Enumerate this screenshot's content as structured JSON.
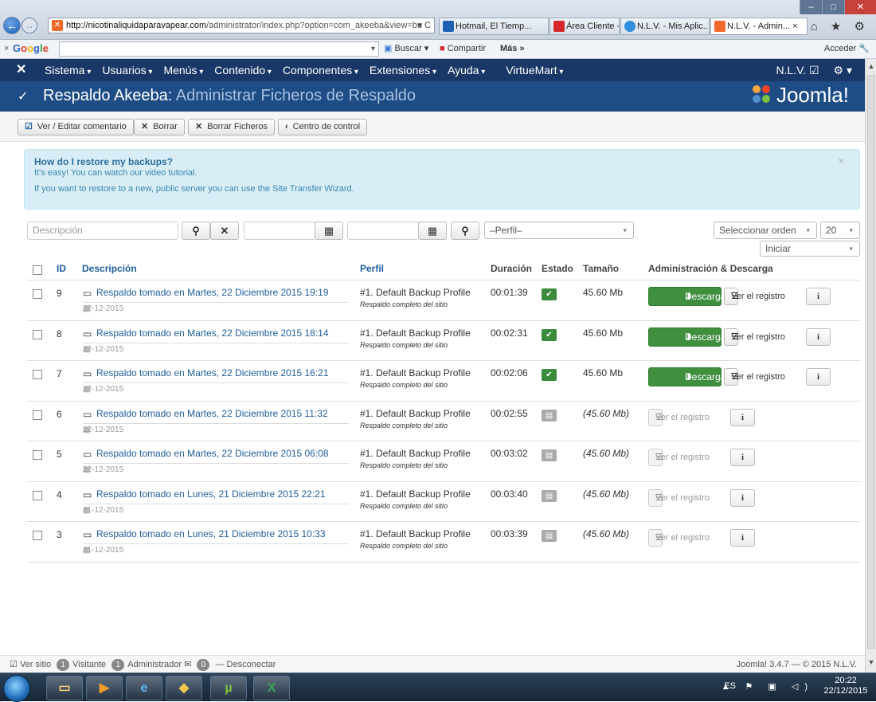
{
  "browser": {
    "url_host": "http://nicotinaliquidaparavapear.com",
    "url_path": "/administrator/index.php?option=com_akeeba&view=bu",
    "url_controls": "▾ C",
    "tabs": [
      {
        "label": "Hotmail, El Tiemp...",
        "color": "#1e5fb4"
      },
      {
        "label": "Área Cliente - We...",
        "color": "#d4262b"
      },
      {
        "label": "N.L.V. - Mis Aplic...",
        "color": "#2f8fdc"
      },
      {
        "label": "N.L.V. - Admin...",
        "color": "#f26a2b",
        "active": true
      }
    ],
    "tab_close": "×",
    "window_controls": {
      "minimize": "–",
      "maximize": "□",
      "close": "✕"
    },
    "right_icons": "⌂ ★ ⚙"
  },
  "google_bar": {
    "close": "×",
    "logo": "Google",
    "search_btn": "Buscar",
    "share_btn": "Compartir",
    "more": "Más »",
    "signin": "Acceder"
  },
  "joomla_nav": {
    "logo": "✕",
    "menu": [
      "Sistema",
      "Usuarios",
      "Menús",
      "Contenido",
      "Componentes",
      "Extensiones",
      "Ayuda",
      "VirtueMart"
    ],
    "user": "N.L.V. ☑",
    "settings": "⚙ ▾"
  },
  "header": {
    "icon": "✓",
    "title_main": "Respaldo Akeeba:",
    "title_sub": " Administrar Ficheros de Respaldo",
    "brand": "Joomla!"
  },
  "toolbar": {
    "view_edit": "Ver / Editar comentario",
    "delete": "Borrar",
    "delete_files": "Borrar Ficheros",
    "control_center": "Centro de control"
  },
  "alert": {
    "heading": "How do I restore my backups?",
    "line1": "It's easy! You can watch our video tutorial.",
    "line2": "If you want to restore to a new, public server you can use the Site Transfer Wizard.",
    "close": "×"
  },
  "filters": {
    "description_placeholder": "Descripción",
    "profile_select": "–Perfil–",
    "order_select": "Seleccionar orden",
    "limit_select": "20",
    "direction_select": "Iniciar"
  },
  "table": {
    "headers": {
      "id": "ID",
      "description": "Descripción",
      "profile": "Perfil",
      "duration": "Duración",
      "status": "Estado",
      "size": "Tamaño",
      "admin": "Administración & Descarga"
    },
    "download_label": "Descargar",
    "log_label": "Ver el registro",
    "info_label": "i",
    "rows": [
      {
        "id": "9",
        "desc": "Respaldo tomado en Martes, 22 Diciembre 2015 19:19",
        "date": "22-12-2015",
        "profile": "#1. Default Backup Profile",
        "profile_sub": "Respaldo completo del sitio",
        "duration": "00:01:39",
        "status": "ok",
        "size": "45.60 Mb"
      },
      {
        "id": "8",
        "desc": "Respaldo tomado en Martes, 22 Diciembre 2015 18:14",
        "date": "22-12-2015",
        "profile": "#1. Default Backup Profile",
        "profile_sub": "Respaldo completo del sitio",
        "duration": "00:02:31",
        "status": "ok",
        "size": "45.60 Mb"
      },
      {
        "id": "7",
        "desc": "Respaldo tomado en Martes, 22 Diciembre 2015 16:21",
        "date": "22-12-2015",
        "profile": "#1. Default Backup Profile",
        "profile_sub": "Respaldo completo del sitio",
        "duration": "00:02:06",
        "status": "ok",
        "size": "45.60 Mb"
      },
      {
        "id": "6",
        "desc": "Respaldo tomado en Martes, 22 Diciembre 2015 11:32",
        "date": "22-12-2015",
        "profile": "#1. Default Backup Profile",
        "profile_sub": "Respaldo completo del sitio",
        "duration": "00:02:55",
        "status": "deleted",
        "size": "(45.60 Mb)"
      },
      {
        "id": "5",
        "desc": "Respaldo tomado en Martes, 22 Diciembre 2015 06:08",
        "date": "22-12-2015",
        "profile": "#1. Default Backup Profile",
        "profile_sub": "Respaldo completo del sitio",
        "duration": "00:03:02",
        "status": "deleted",
        "size": "(45.60 Mb)"
      },
      {
        "id": "4",
        "desc": "Respaldo tomado en Lunes, 21 Diciembre 2015 22:21",
        "date": "21-12-2015",
        "profile": "#1. Default Backup Profile",
        "profile_sub": "Respaldo completo del sitio",
        "duration": "00:03:40",
        "status": "deleted",
        "size": "(45.60 Mb)"
      },
      {
        "id": "3",
        "desc": "Respaldo tomado en Lunes, 21 Diciembre 2015 10:33",
        "date": "21-12-2015",
        "profile": "#1. Default Backup Profile",
        "profile_sub": "Respaldo completo del sitio",
        "duration": "00:03:39",
        "status": "deleted",
        "size": "(45.60 Mb)"
      }
    ]
  },
  "statusbar": {
    "view_site": "Ver sitio",
    "visitors_count": "1",
    "visitors_label": "Visitante",
    "admins_count": "1",
    "admins_label": "Administrador",
    "messages_count": "0",
    "logout": "Desconectar",
    "version": "Joomla! 3.4.7 — © 2015 N.L.V."
  },
  "taskbar": {
    "lang": "ES",
    "time": "20:22",
    "date": "22/12/2015"
  },
  "colors": {
    "joomla_nav": "#1a3867",
    "joomla_header": "#1e4d86",
    "download_green": "#3f8f3f",
    "link_blue": "#1f5e9e"
  }
}
